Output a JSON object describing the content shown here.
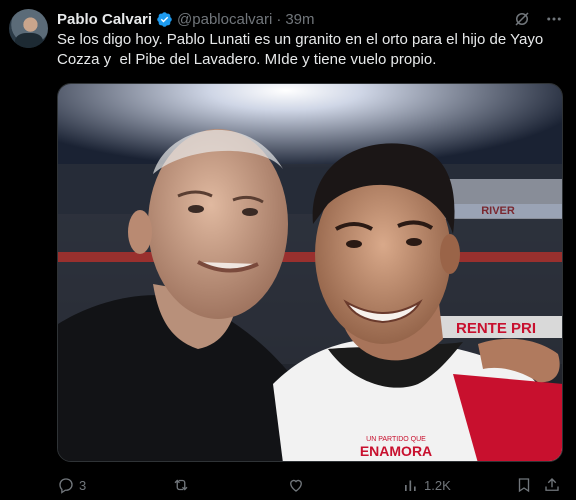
{
  "tweet": {
    "author_name": "Pablo Calvari",
    "author_handle": "@pablocalvari",
    "separator": "·",
    "time": "39m",
    "text": "Se los digo hoy. Pablo Lunati es un granito en el orto para el hijo de Yayo\nCozza y  el Pibe del Lavadero. MIde y tiene vuelo propio."
  },
  "media": {
    "shirt_text_line1": "UN PARTIDO QUE",
    "shirt_text_line2": "ENAMORA",
    "banner_text_1": "RENTE PRI",
    "banner_text_2": "RIVER"
  },
  "actions": {
    "reply_count": "3",
    "repost_count": "",
    "like_count": "",
    "views_count": "1.2K"
  },
  "colors": {
    "accent": "#1d9bf0",
    "muted": "#71767b",
    "background": "#000000"
  }
}
